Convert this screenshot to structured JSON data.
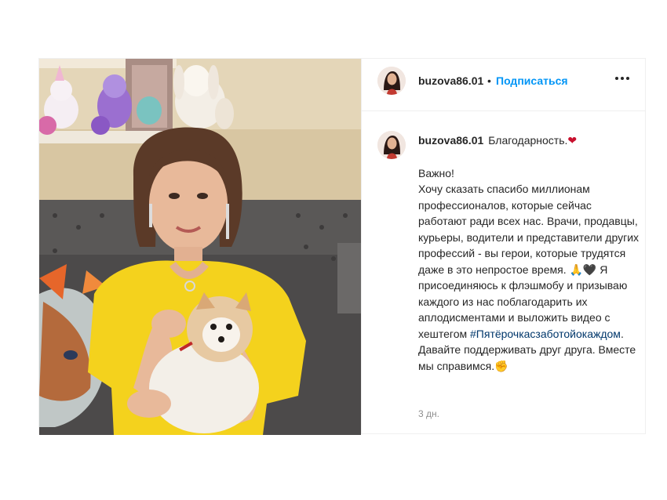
{
  "post": {
    "image_alt": "Фото публикации",
    "author": {
      "username": "buzova86.01",
      "separator": "•",
      "follow_label": "Подписаться",
      "more_icon": "more-horizontal-icon"
    },
    "caption": {
      "username": "buzova86.01",
      "first_line": "Благодарность.",
      "first_emoji": "❤",
      "body": "Важно!\nХочу сказать спасибо миллионам профессионалов, которые сейчас работают ради всех нас. Врачи, продавцы, курьеры, водители и представители других профессий - вы герои, которые трудятся даже в это непростое время. 🙏🖤 Я присоединяюсь к флэшмобу и призываю каждого из нас поблагодарить их аплодисментами и выложить видео с хештегом ",
      "hashtag": "#Пятёрочкасзаботойокаждом",
      "body_end": ".\nДавайте поддерживать друг друга. Вместе мы справимся.",
      "end_emoji": "✊"
    },
    "timestamp": "3 дн.",
    "colors": {
      "link": "#0095f6",
      "hashtag": "#00376b",
      "shirt": "#f4d21d"
    }
  }
}
